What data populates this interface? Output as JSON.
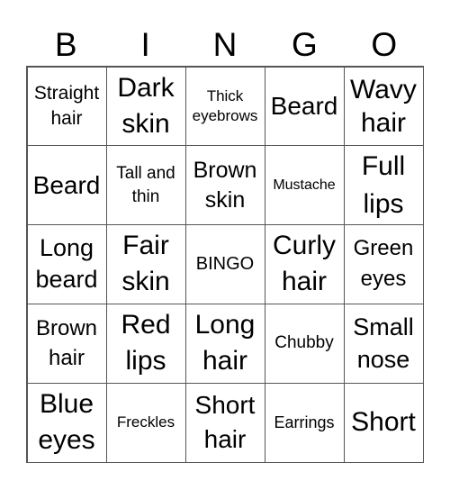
{
  "header": {
    "letters": [
      "B",
      "I",
      "N",
      "G",
      "O"
    ]
  },
  "cells": [
    [
      "Straight hair",
      "Dark skin",
      "Thick eyebrows",
      "Beard",
      "Wavy hair"
    ],
    [
      "Beard",
      "Tall and thin",
      "Brown skin",
      "Mustache",
      "Full lips"
    ],
    [
      "Long beard",
      "Fair skin",
      "BINGO",
      "Curly hair",
      "Green eyes"
    ],
    [
      "Brown hair",
      "Red lips",
      "Long hair",
      "Chubby",
      "Small nose"
    ],
    [
      "Blue eyes",
      "Freckles",
      "Short hair",
      "Earrings",
      "Short"
    ]
  ]
}
